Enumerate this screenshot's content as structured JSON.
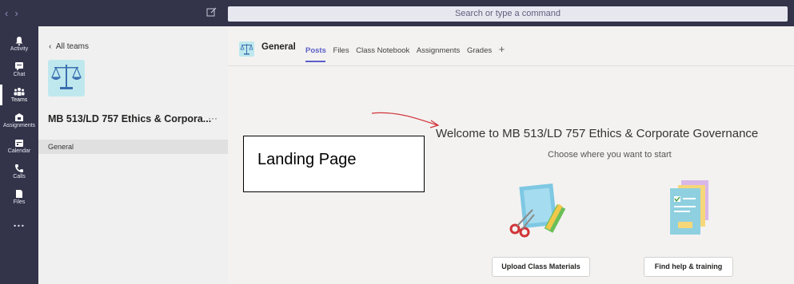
{
  "topbar": {
    "search_placeholder": "Search or type a command",
    "back_icon": "chevron-left-icon",
    "forward_icon": "chevron-right-icon",
    "compose_icon": "compose-icon"
  },
  "rail": {
    "items": [
      {
        "label": "Activity",
        "icon": "bell-icon"
      },
      {
        "label": "Chat",
        "icon": "chat-icon"
      },
      {
        "label": "Teams",
        "icon": "teams-icon"
      },
      {
        "label": "Assignments",
        "icon": "assignments-icon"
      },
      {
        "label": "Calendar",
        "icon": "calendar-icon"
      },
      {
        "label": "Calls",
        "icon": "phone-icon"
      },
      {
        "label": "Files",
        "icon": "file-icon"
      },
      {
        "label": "...",
        "icon": "more-icon"
      }
    ]
  },
  "teampane": {
    "all_teams": "All teams",
    "team_name": "MB 513/LD 757 Ethics & Corpora...",
    "more": "···",
    "channel": "General"
  },
  "header": {
    "channel_title": "General",
    "tabs": [
      "Posts",
      "Files",
      "Class Notebook",
      "Assignments",
      "Grades"
    ],
    "add_tab": "+"
  },
  "main": {
    "welcome": "Welcome to MB 513/LD 757 Ethics & Corporate Governance",
    "choose": "Choose where you want to start",
    "annotation": "Landing Page",
    "upload_button": "Upload Class Materials",
    "help_button": "Find help & training"
  },
  "colors": {
    "rail_bg": "#33344a",
    "accent": "#5b5fc7",
    "annotation_arrow": "#d13438"
  }
}
